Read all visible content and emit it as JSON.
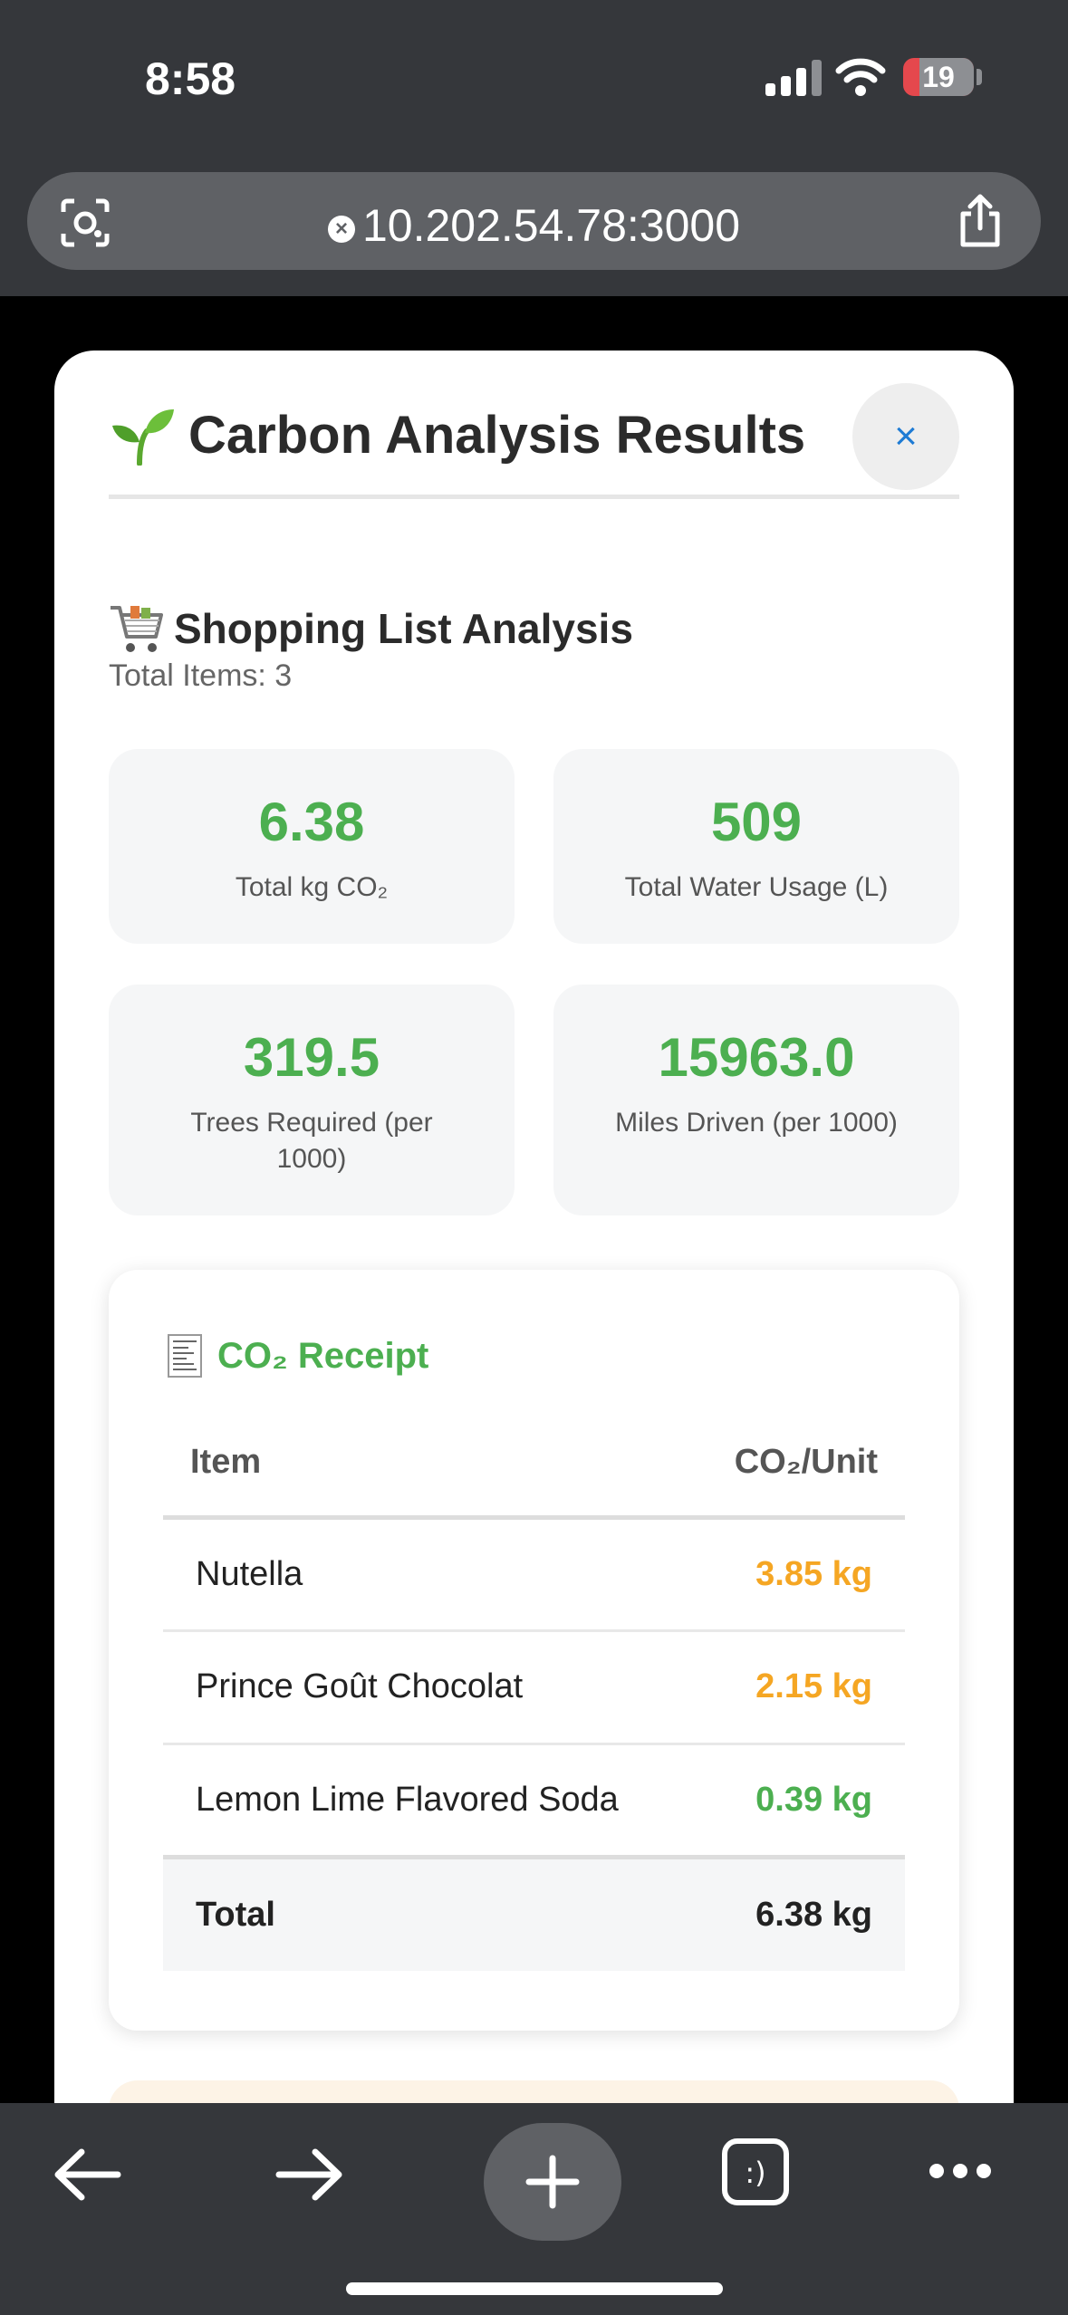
{
  "status": {
    "time": "8:58",
    "battery": "19"
  },
  "browser": {
    "url": "10.202.54.78:3000"
  },
  "modal": {
    "title": "Carbon Analysis Results",
    "close_label": "×",
    "section_title": "Shopping List Analysis",
    "total_items": "Total Items: 3",
    "stats": [
      {
        "value": "6.38",
        "label": "Total kg CO₂"
      },
      {
        "value": "509",
        "label": "Total Water Usage (L)"
      },
      {
        "value": "319.5",
        "label": "Trees Required (per 1000)"
      },
      {
        "value": "15963.0",
        "label": "Miles Driven (per 1000)"
      }
    ],
    "receipt": {
      "title": "CO₂ Receipt",
      "col_item": "Item",
      "col_unit": "CO₂/Unit",
      "rows": [
        {
          "item": "Nutella",
          "value": "3.85 kg",
          "color": "#f5a623"
        },
        {
          "item": "Prince Goût Chocolat",
          "value": "2.15 kg",
          "color": "#f5a623"
        },
        {
          "item": "Lemon Lime Flavored Soda",
          "value": "0.39 kg",
          "color": "#4caf50"
        }
      ],
      "total_label": "Total",
      "total_value": "6.38 kg"
    }
  },
  "colors": {
    "accent_green": "#4caf50",
    "accent_orange": "#f5a623",
    "close_blue": "#1e7bd4"
  },
  "icons": [
    "signal-icon",
    "wifi-icon",
    "battery-icon",
    "lens-icon",
    "share-icon",
    "sprout-icon",
    "cart-icon",
    "receipt-icon",
    "back-icon",
    "forward-icon",
    "plus-icon",
    "tabs-icon",
    "more-icon"
  ]
}
